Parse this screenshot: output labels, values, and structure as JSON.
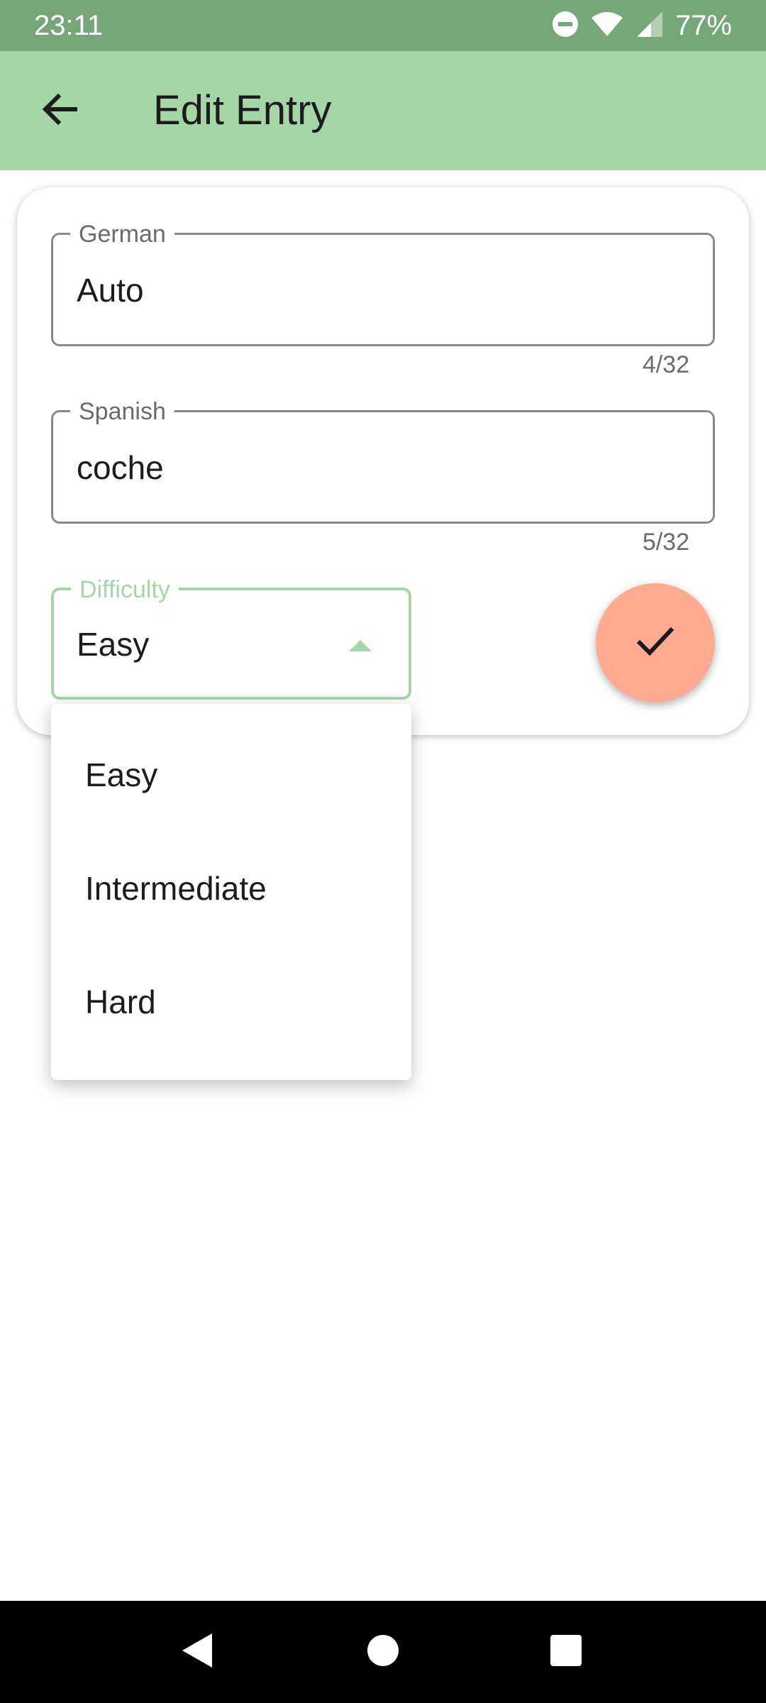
{
  "status_bar": {
    "time": "23:11",
    "battery": "77%",
    "icons": [
      "do-not-disturb-icon",
      "wifi-icon",
      "signal-icon"
    ]
  },
  "app_bar": {
    "title": "Edit Entry",
    "back_icon": "arrow-back-icon"
  },
  "form": {
    "german": {
      "label": "German",
      "value": "Auto",
      "counter": "4/32"
    },
    "spanish": {
      "label": "Spanish",
      "value": "coche",
      "counter": "5/32"
    },
    "difficulty": {
      "label": "Difficulty",
      "value": "Easy",
      "options": [
        "Easy",
        "Intermediate",
        "Hard"
      ]
    },
    "save_icon": "check-icon"
  },
  "colors": {
    "status_bar": "#76a778",
    "app_bar": "#a5d6a7",
    "accent": "#a5d6a7",
    "fab": "#ffab91"
  },
  "nav_bar": {
    "icons": [
      "back-triangle-icon",
      "home-circle-icon",
      "recents-square-icon"
    ]
  }
}
